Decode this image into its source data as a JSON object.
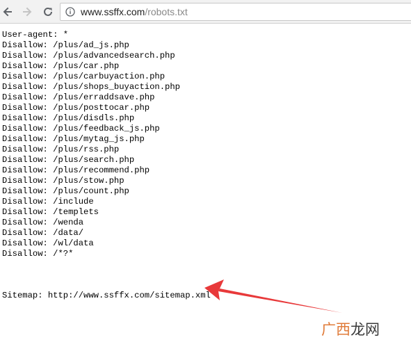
{
  "browser": {
    "url_domain": "www.ssffx.com",
    "url_path": "/robots.txt",
    "icons": {
      "back": "back-arrow-icon",
      "forward": "forward-arrow-icon",
      "reload": "reload-icon",
      "info": "info-icon"
    }
  },
  "robots": {
    "lines": [
      "User-agent: *",
      "Disallow: /plus/ad_js.php",
      "Disallow: /plus/advancedsearch.php",
      "Disallow: /plus/car.php",
      "Disallow: /plus/carbuyaction.php",
      "Disallow: /plus/shops_buyaction.php",
      "Disallow: /plus/erraddsave.php",
      "Disallow: /plus/posttocar.php",
      "Disallow: /plus/disdls.php",
      "Disallow: /plus/feedback_js.php",
      "Disallow: /plus/mytag_js.php",
      "Disallow: /plus/rss.php",
      "Disallow: /plus/search.php",
      "Disallow: /plus/recommend.php",
      "Disallow: /plus/stow.php",
      "Disallow: /plus/count.php",
      "Disallow: /include",
      "Disallow: /templets",
      "Disallow: /wenda",
      "Disallow: /data/",
      "Disallow: /wl/data",
      "Disallow: /*?*"
    ],
    "sitemap": "Sitemap: http://www.ssffx.com/sitemap.xml"
  },
  "annotation": {
    "arrow_color": "#e8393a"
  },
  "watermark": {
    "part1": "广西",
    "part2": "龙网"
  }
}
